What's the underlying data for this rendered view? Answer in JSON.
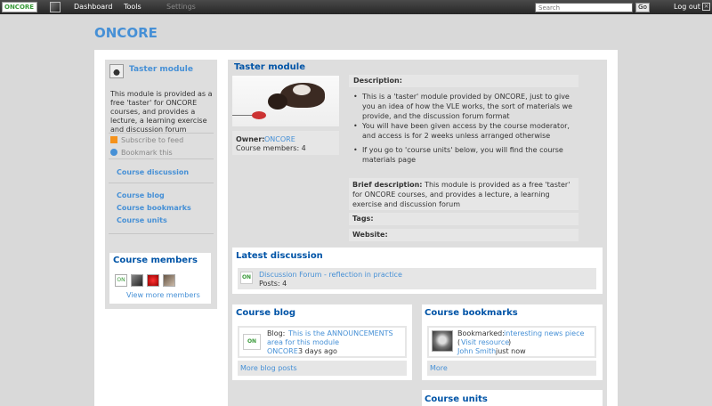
{
  "topbar": {
    "logo_text": "ONCORE",
    "nav": [
      "Dashboard",
      "Tools",
      "Settings"
    ],
    "search_placeholder": "Search",
    "go_label": "Go",
    "logout_label": "Log out",
    "logout_icon": "close-icon"
  },
  "site_title": "ONCORE",
  "sidebar": {
    "module_title": "Taster module",
    "description": "This module is provided as a free 'taster' for ONCORE courses, and provides a lecture, a learning exercise and discussion forum",
    "subscribe": "Subscribe to feed",
    "bookmark": "Bookmark this",
    "links": [
      "Course discussion",
      "Course blog",
      "Course bookmarks",
      "Course units"
    ],
    "members_title": "Course members",
    "view_more": "View more members"
  },
  "main": {
    "title": "Taster module",
    "owner_label": "Owner:",
    "owner_value": "ONCORE",
    "members_count": "Course members: 4",
    "description_label": "Description:",
    "description_items": [
      "This is a 'taster' module provided by ONCORE, just to give you an idea of how the VLE works, the sort of materials we provide, and the discussion forum format",
      "You will have been given access by the course moderator, and access is for 2 weeks unless arranged otherwise",
      "If you go to 'course units' below, you will find the course materials page"
    ],
    "brief_label": "Brief description:",
    "brief_text": "This module is provided as a free 'taster' for ONCORE courses, and provides a lecture, a learning exercise and discussion forum",
    "tags_label": "Tags:",
    "website_label": "Website:"
  },
  "latest_discussion": {
    "title": "Latest discussion",
    "topic": "Discussion Forum - reflection in practice",
    "posts": "Posts: 4"
  },
  "course_blog": {
    "title": "Course blog",
    "prefix": "Blog:",
    "post_line1": "This is the ANNOUNCEMENTS",
    "post_line2": "area for this module",
    "author": "ONCORE",
    "time": "3 days ago",
    "more": "More blog posts"
  },
  "course_bookmarks": {
    "title": "Course bookmarks",
    "prefix": "Bookmarked:",
    "link": "interesting news piece",
    "visit": "Visit resource",
    "author": "John Smith",
    "time": "just now",
    "more": "More"
  },
  "course_units": {
    "title": "Course units"
  }
}
